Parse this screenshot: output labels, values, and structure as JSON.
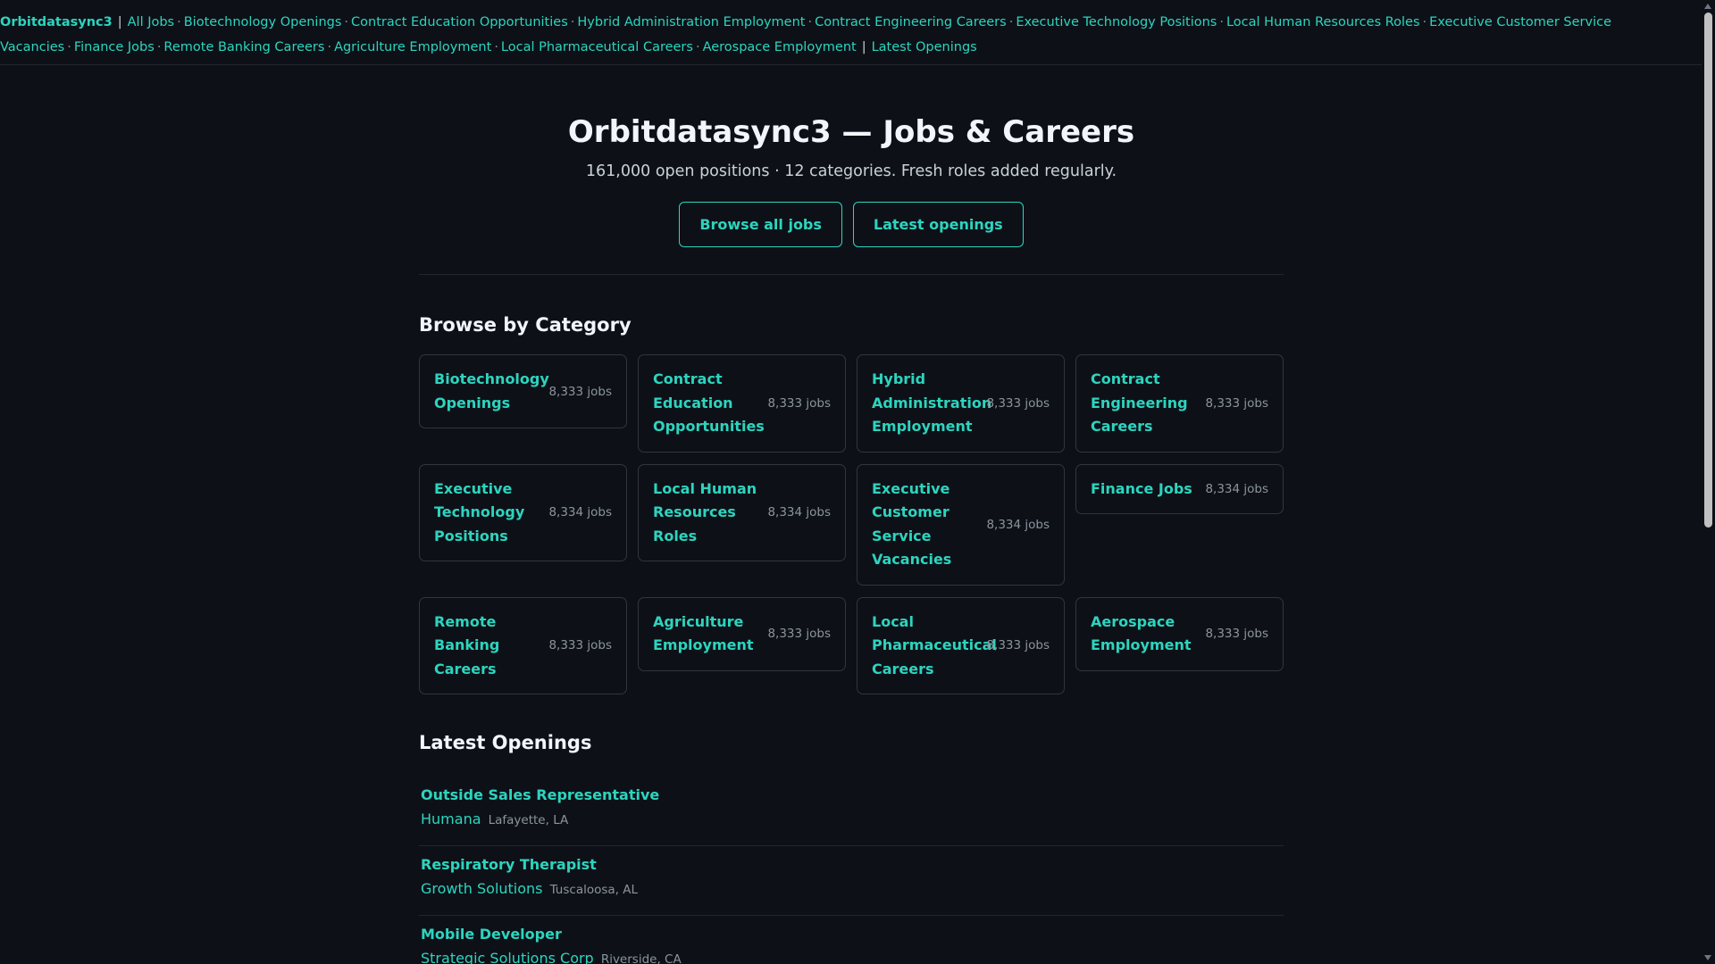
{
  "site": {
    "brand": "Orbitdatasync3"
  },
  "nav": {
    "all_jobs": "All Jobs",
    "categories": [
      "Biotechnology Openings",
      "Contract Education Opportunities",
      "Hybrid Administration Employment",
      "Contract Engineering Careers",
      "Executive Technology Positions",
      "Local Human Resources Roles",
      "Executive Customer Service Vacancies",
      "Finance Jobs",
      "Remote Banking Careers",
      "Agriculture Employment",
      "Local Pharmaceutical Careers",
      "Aerospace Employment"
    ],
    "latest": "Latest Openings"
  },
  "hero": {
    "title": "Orbitdatasync3 — Jobs & Careers",
    "subtitle": "161,000 open positions · 12 categories. Fresh roles added regularly.",
    "browse_button": "Browse all jobs",
    "latest_button": "Latest openings"
  },
  "categories_section": {
    "title": "Browse by Category",
    "items": [
      {
        "name": "Biotechnology Openings",
        "count": "8,333 jobs"
      },
      {
        "name": "Contract Education Opportunities",
        "count": "8,333 jobs"
      },
      {
        "name": "Hybrid Administration Employment",
        "count": "8,333 jobs"
      },
      {
        "name": "Contract Engineering Careers",
        "count": "8,333 jobs"
      },
      {
        "name": "Executive Technology Positions",
        "count": "8,334 jobs"
      },
      {
        "name": "Local Human Resources Roles",
        "count": "8,334 jobs"
      },
      {
        "name": "Executive Customer Service Vacancies",
        "count": "8,334 jobs"
      },
      {
        "name": "Finance Jobs",
        "count": "8,334 jobs"
      },
      {
        "name": "Remote Banking Careers",
        "count": "8,333 jobs"
      },
      {
        "name": "Agriculture Employment",
        "count": "8,333 jobs"
      },
      {
        "name": "Local Pharmaceutical Careers",
        "count": "8,333 jobs"
      },
      {
        "name": "Aerospace Employment",
        "count": "8,333 jobs"
      }
    ]
  },
  "openings_section": {
    "title": "Latest Openings",
    "jobs": [
      {
        "title": "Outside Sales Representative",
        "company": "Humana",
        "location": "Lafayette, LA"
      },
      {
        "title": "Respiratory Therapist",
        "company": "Growth Solutions",
        "location": "Tuscaloosa, AL"
      },
      {
        "title": "Mobile Developer",
        "company": "Strategic Solutions Corp",
        "location": "Riverside, CA"
      }
    ]
  },
  "theme": {
    "background": "#0d1117",
    "accent": "#2dd4bf",
    "text": "#f0f6fc",
    "muted": "#8b949e",
    "border": "#30363d"
  }
}
